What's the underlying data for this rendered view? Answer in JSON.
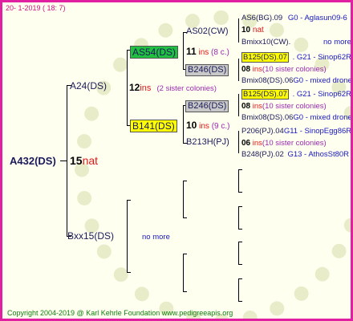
{
  "header": {
    "date": "20-  1-2019 ( 18:  7)"
  },
  "footer": {
    "copyright": "Copyright 2004-2019 @ Karl Kehrle Foundation   www.pedigreeapis.org"
  },
  "root": {
    "name": "A432(DS)",
    "num": "15",
    "suffix": "nat"
  },
  "sire": {
    "name": "A24(DS)",
    "num": "12",
    "suffix": "ins",
    "note": "(2 sister colonies)"
  },
  "dam": {
    "name": "Bxx15(DS)",
    "note": "no more"
  },
  "ss": {
    "name": "AS54(DS)",
    "num": "11",
    "suffix": "ins",
    "note": "(8 c.)"
  },
  "sd": {
    "name": "B141(DS)",
    "num": "10",
    "suffix": "ins",
    "note": "(9 c.)"
  },
  "sss": {
    "name": "AS02(CW)",
    "num": "10",
    "suffix": "nat"
  },
  "ssd": {
    "name": "B246(DS)"
  },
  "sds": {
    "name": "B246(DS)"
  },
  "sdd": {
    "name": "B213H(PJ)"
  },
  "g1": {
    "name": "AS6(BG).09",
    "info": "G0 - Aglasun09-6"
  },
  "g2": {
    "name": "Bmixx10(CW).",
    "info": "no more"
  },
  "g3": {
    "name": "B125(DS).07",
    "info": ". G21 - Sinop62R",
    "num": "08",
    "suffix": "ins",
    "note": "(10 sister colonies)"
  },
  "g4": {
    "name": "Bmix08(DS).06",
    "info": "G0 - mixed drone"
  },
  "g5": {
    "name": "B125(DS).07",
    "info": ". G21 - Sinop62R",
    "num": "08",
    "suffix": "ins",
    "note": "(10 sister colonies)"
  },
  "g6": {
    "name": "Bmix08(DS).06",
    "info": "G0 - mixed drone"
  },
  "g7": {
    "name": "P206(PJ).04",
    "info": "G11 - SinopEgg86R",
    "num": "06",
    "suffix": "ins",
    "note": "(10 sister colonies)"
  },
  "g8": {
    "name": "B248(PJ).02",
    "info": "G13 - AthosSt80R"
  }
}
